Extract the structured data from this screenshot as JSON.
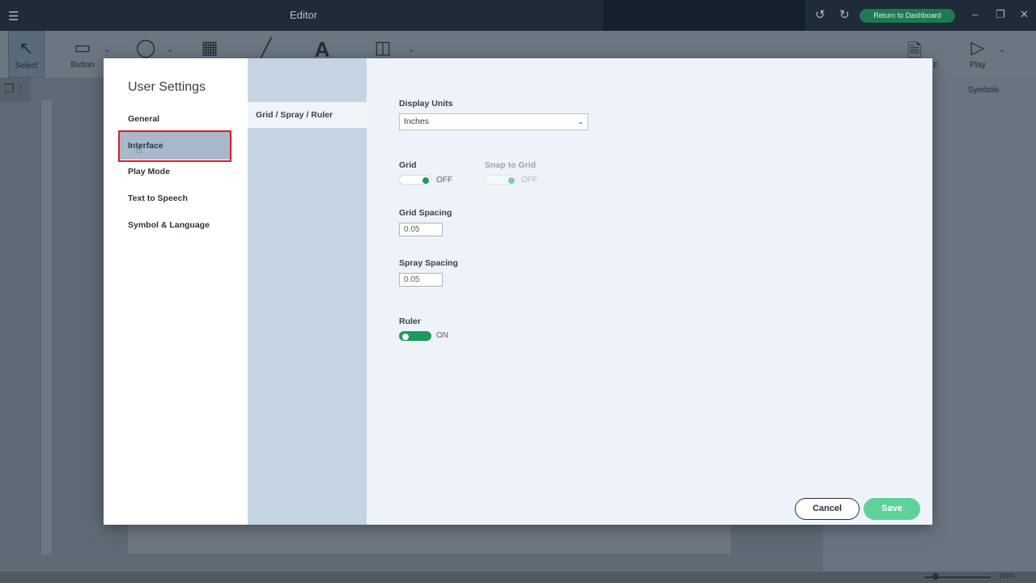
{
  "app": {
    "window_title": "Editor",
    "return_button": "Return to Dashboard"
  },
  "toolbar": {
    "select_label": "Select",
    "button_label": "Button",
    "pdf_label_partial": "F",
    "play_label": "Play"
  },
  "workspace": {
    "symbols_label": "Symbols",
    "zoom": "109%"
  },
  "modal": {
    "title": "User Settings",
    "nav": [
      {
        "label": "General"
      },
      {
        "label": "Interface",
        "selected": true
      },
      {
        "label": "Play Mode"
      },
      {
        "label": "Text to Speech"
      },
      {
        "label": "Symbol & Language"
      }
    ],
    "subnav": [
      {
        "label": "Grid / Spray / Ruler",
        "selected": true
      }
    ],
    "content": {
      "display_units_label": "Display Units",
      "display_units_value": "Inches",
      "grid_label": "Grid",
      "grid_state": "OFF",
      "snap_label": "Snap to Grid",
      "snap_state": "OFF",
      "grid_spacing_label": "Grid Spacing",
      "grid_spacing_value": "0.05",
      "spray_spacing_label": "Spray Spacing",
      "spray_spacing_value": "0.05",
      "ruler_label": "Ruler",
      "ruler_state": "ON"
    },
    "cancel": "Cancel",
    "save": "Save"
  },
  "colors": {
    "accent_green": "#1c9a5c",
    "save_green": "#5fd19a",
    "highlight_red": "#e01b24",
    "selected_nav": "#a9b9cb",
    "subnav_bg": "#c5d4e3",
    "content_bg": "#eef3fa"
  }
}
